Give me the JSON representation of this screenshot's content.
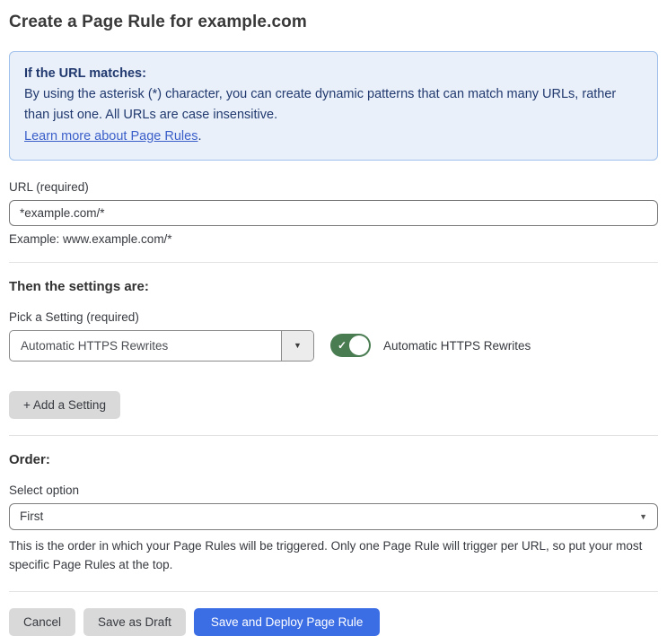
{
  "page_title": "Create a Page Rule for example.com",
  "info_box": {
    "heading": "If the URL matches:",
    "body": "By using the asterisk (*) character, you can create dynamic patterns that can match many URLs, rather than just one. All URLs are case insensitive.",
    "link_label": "Learn more about Page Rules",
    "link_suffix": "."
  },
  "url_field": {
    "label": "URL (required)",
    "value": "*example.com/*",
    "helper": "Example: www.example.com/*"
  },
  "settings_section": {
    "heading": "Then the settings are:",
    "setting_label": "Pick a Setting (required)",
    "setting_value": "Automatic HTTPS Rewrites",
    "toggle_label": "Automatic HTTPS Rewrites",
    "toggle_state": "on",
    "add_setting_button": "+ Add a Setting"
  },
  "order_section": {
    "heading": "Order:",
    "select_label": "Select option",
    "select_value": "First",
    "helper": "This is the order in which your Page Rules will be triggered. Only one Page Rule will trigger per URL, so put your most specific Page Rules at the top."
  },
  "footer": {
    "cancel_label": "Cancel",
    "save_draft_label": "Save as Draft",
    "save_deploy_label": "Save and Deploy Page Rule"
  },
  "icons": {
    "dropdown_arrow": "▼",
    "select_arrow": "▼",
    "toggle_check": "✓"
  },
  "colors": {
    "info_box_bg": "#e9f0fa",
    "info_box_border": "#9fc0ea",
    "info_text": "#21396e",
    "link_blue": "#3b5fc9",
    "toggle_green": "#4a7c52",
    "primary_button_blue": "#3b6de4",
    "secondary_button_gray": "#d9d9d9",
    "text_dark": "#36393f"
  }
}
